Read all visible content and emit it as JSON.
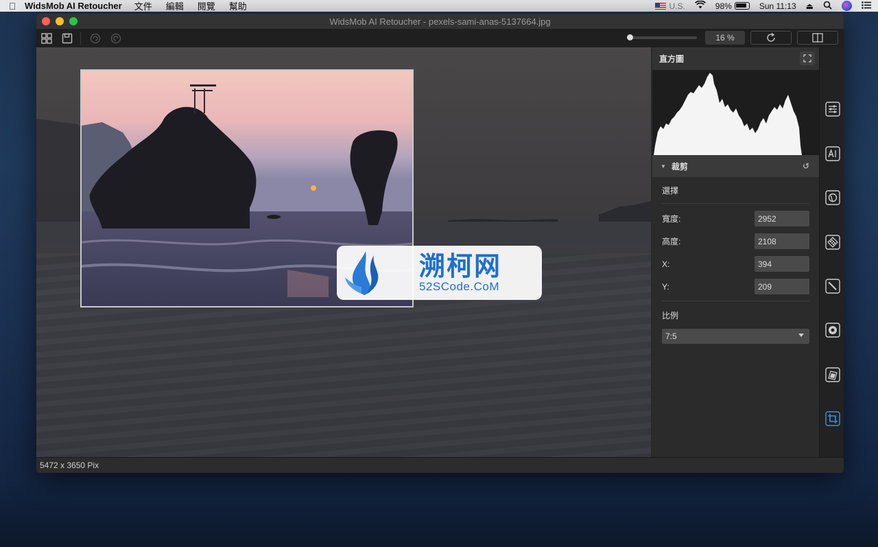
{
  "menubar": {
    "app_name": "WidsMob AI Retoucher",
    "items": [
      "文件",
      "編輯",
      "閱覽",
      "幫助"
    ],
    "input_source": "U.S.",
    "battery": "98%",
    "clock": "Sun 11:13"
  },
  "window": {
    "title": "WidsMob AI Retoucher - pexels-sami-anas-5137664.jpg"
  },
  "toolbar": {
    "zoom_value": "16 %"
  },
  "status": {
    "dimensions": "5472 x 3650 Pix"
  },
  "panel": {
    "histogram_title": "直方圖",
    "crop_section": "裁剪",
    "select_label": "選擇",
    "width_label": "寬度:",
    "width_value": "2952",
    "height_label": "高度:",
    "height_value": "2108",
    "x_label": "X:",
    "x_value": "394",
    "y_label": "Y:",
    "y_value": "209",
    "ratio_label": "比例",
    "ratio_value": "7:5"
  },
  "watermark": {
    "cn": "溯柯网",
    "en": "52SCode.CoM"
  },
  "colors": {
    "accent": "#3b8fe0",
    "menubar_bg": "#e6e8ea",
    "panel_bg": "#2b2b2b"
  }
}
